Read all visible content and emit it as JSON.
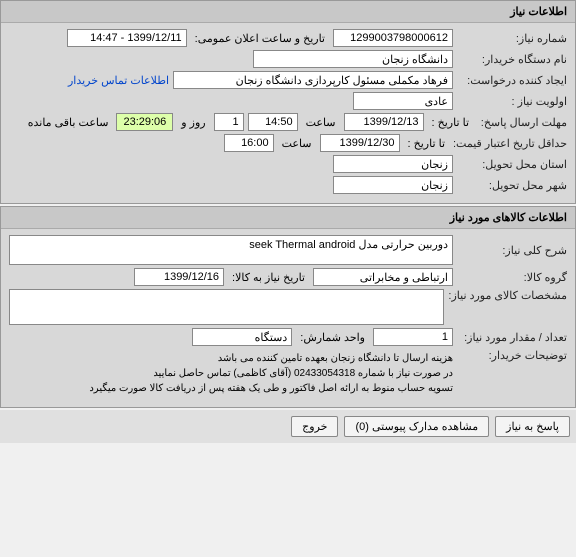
{
  "panel1": {
    "title": "اطلاعات نیاز",
    "need_number_label": "شماره نیاز:",
    "need_number": "1299003798000612",
    "announce_label": "تاریخ و ساعت اعلان عمومی:",
    "announce_value": "1399/12/11 - 14:47",
    "buyer_label": "نام دستگاه خریدار:",
    "buyer_value": "دانشگاه زنجان",
    "requester_label": "ایجاد کننده درخواست:",
    "requester_value": "فرهاد مکملی مسئول کارپردازی دانشگاه زنجان",
    "contact_link": "اطلاعات تماس خریدار",
    "priority_label": "اولویت نیاز :",
    "priority_value": "عادی",
    "deadline_label": "مهلت ارسال پاسخ:",
    "to_date_label": "تا تاریخ :",
    "deadline_date": "1399/12/13",
    "time_label": "ساعت",
    "deadline_time": "14:50",
    "days_value": "1",
    "days_label": "روز و",
    "remaining_time": "23:29:06",
    "remaining_label": "ساعت باقی مانده",
    "min_validity_label": "حداقل تاریخ اعتبار قیمت:",
    "validity_date": "1399/12/30",
    "validity_time": "16:00",
    "delivery_state_label": "استان محل تحویل:",
    "delivery_state": "زنجان",
    "delivery_city_label": "شهر محل تحویل:",
    "delivery_city": "زنجان"
  },
  "panel2": {
    "title": "اطلاعات کالاهای مورد نیاز",
    "general_desc_label": "شرح کلی نیاز:",
    "general_desc": "دوربین حرارتی مدل seek Thermal android",
    "group_label": "گروه کالا:",
    "group_value": "ارتباطی و مخابراتی",
    "need_date_label": "تاریخ نیاز به کالا:",
    "need_date": "1399/12/16",
    "specs_label": "مشخصات کالای مورد نیاز:",
    "specs_value": "",
    "qty_label": "تعداد / مقدار مورد نیاز:",
    "qty_value": "1",
    "unit_label": "واحد شمارش:",
    "unit_value": "دستگاه",
    "buyer_notes_label": "توضیحات خریدار:",
    "note1": "هزینه ارسال تا دانشگاه زنجان بعهده تامین کننده می باشد",
    "note2": "در صورت نیاز با شماره 02433054318 (آقای کاظمی) تماس حاصل نمایید",
    "note3": "تسویه حساب منوط به ارائه اصل فاکتور و طی یک هفته پس از دریافت کالا صورت میگیرد"
  },
  "footer": {
    "reply": "پاسخ به نیاز",
    "view_docs": "مشاهده مدارک پیوستی (0)",
    "exit": "خروج"
  }
}
